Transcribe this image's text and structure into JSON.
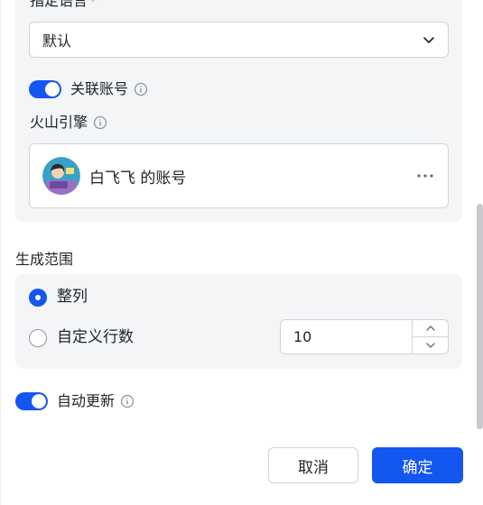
{
  "language": {
    "label": "指定语言",
    "required_mark": "*",
    "select_value": "默认"
  },
  "link_account": {
    "toggle_on": true,
    "label": "关联账号"
  },
  "engine": {
    "label": "火山引擎",
    "account_name": "白飞飞 的账号",
    "more_glyph": "···"
  },
  "range": {
    "title": "生成范围",
    "options": [
      {
        "label": "整列",
        "selected": true
      },
      {
        "label": "自定义行数",
        "selected": false
      }
    ],
    "rows_value": "10"
  },
  "auto_update": {
    "toggle_on": true,
    "label": "自动更新"
  },
  "footer": {
    "cancel_label": "取消",
    "confirm_label": "确定"
  },
  "colors": {
    "accent": "#1456f0",
    "panel_bg": "#f4f5f7",
    "border": "#d0d3d6"
  }
}
